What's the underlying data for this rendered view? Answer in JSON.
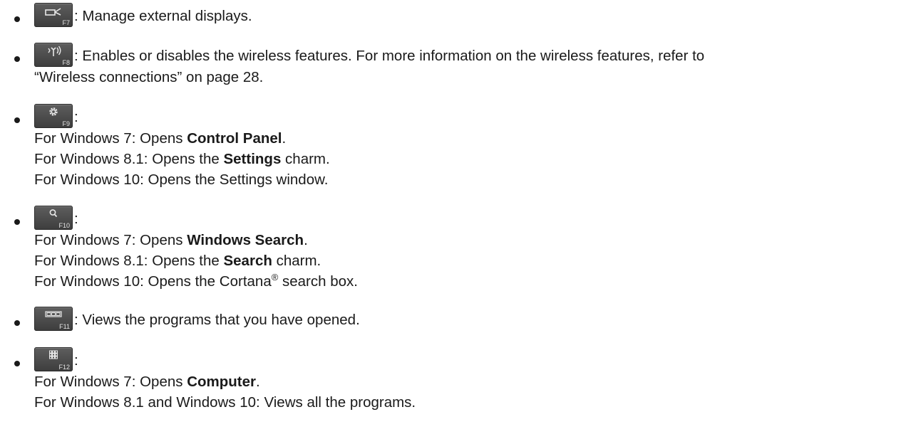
{
  "items": [
    {
      "key": "F7",
      "icon": "external-display-icon",
      "text": ": Manage external displays."
    },
    {
      "key": "F8",
      "icon": "wireless-icon",
      "text": ": Enables or disables the wireless features. For more information on the wireless features, refer to",
      "cont": "“Wireless connections” on page 28."
    },
    {
      "key": "F9",
      "icon": "settings-gear-icon",
      "colon": ":",
      "lines": [
        {
          "pre": "For Windows 7: Opens ",
          "bold": "Control Panel",
          "post": "."
        },
        {
          "pre": "For Windows 8.1: Opens the ",
          "bold": "Settings",
          "post": " charm."
        },
        {
          "pre": "For Windows 10: Opens the Settings window.",
          "bold": "",
          "post": ""
        }
      ]
    },
    {
      "key": "F10",
      "icon": "search-icon",
      "colon": ":",
      "lines": [
        {
          "pre": "For Windows 7: Opens ",
          "bold": "Windows Search",
          "post": "."
        },
        {
          "pre": "For Windows 8.1: Opens the ",
          "bold": "Search",
          "post": " charm."
        },
        {
          "pre": "For Windows 10: Opens the Cortana",
          "sup": "®",
          "post": " search box."
        }
      ]
    },
    {
      "key": "F11",
      "icon": "open-programs-icon",
      "text": ": Views the programs that you have opened."
    },
    {
      "key": "F12",
      "icon": "all-programs-grid-icon",
      "colon": ":",
      "lines": [
        {
          "pre": "For Windows 7: Opens ",
          "bold": "Computer",
          "post": "."
        },
        {
          "pre": "For Windows 8.1 and Windows 10: Views all the programs.",
          "bold": "",
          "post": ""
        }
      ]
    }
  ]
}
